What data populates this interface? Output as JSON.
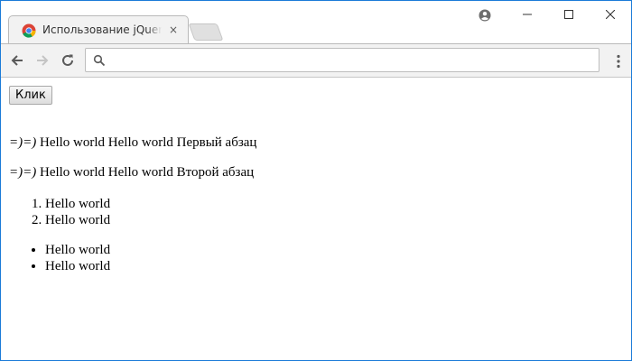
{
  "browser": {
    "tab": {
      "title": "Использование jQuery",
      "close_glyph": "×"
    },
    "window_controls": {
      "minimize_glyph": "—",
      "maximize_glyph": "☐",
      "close_glyph": "✕"
    },
    "address": {
      "value": "",
      "placeholder": ""
    },
    "colors": {
      "window_border": "#1b7bd8",
      "toolbar": "#f2f2f2"
    }
  },
  "page": {
    "button_label": "Клик",
    "paragraphs": [
      {
        "prefix": "=)=)",
        "text": " Hello world Hello world Первый абзац"
      },
      {
        "prefix": "=)=)",
        "text": " Hello world Hello world Второй абзац"
      }
    ],
    "ordered_list": [
      "Hello world",
      "Hello world"
    ],
    "unordered_list": [
      "Hello world",
      "Hello world"
    ]
  }
}
